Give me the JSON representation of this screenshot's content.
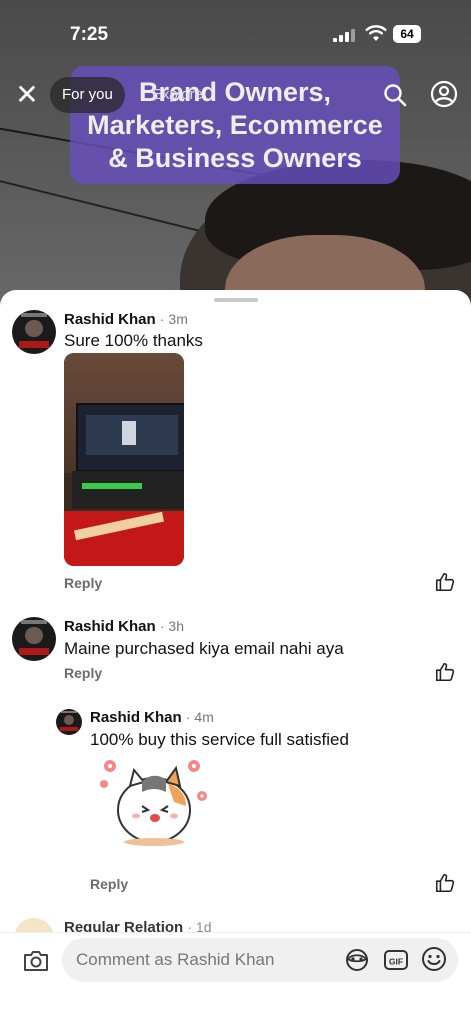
{
  "status_bar": {
    "time": "7:25",
    "battery": "64"
  },
  "top_nav": {
    "tab_for_you": "For you",
    "tab_explore": "Explore"
  },
  "overlay": {
    "text": "Brand Owners, Marketers, Ecommerce & Business Owners"
  },
  "comments": [
    {
      "name": "Rashid Khan",
      "age": "· 3m",
      "text": "Sure 100% thanks",
      "reply": "Reply"
    },
    {
      "name": "Rashid Khan",
      "age": "· 3h",
      "text": "Maine purchased kiya email nahi aya",
      "reply": "Reply"
    },
    {
      "name": "Rashid Khan",
      "age": "· 4m",
      "text": "100% buy this service full satisfied",
      "reply": "Reply"
    }
  ],
  "partial_comment": {
    "name": "Regular Relation",
    "age": "· 1d"
  },
  "input": {
    "placeholder": "Comment as Rashid Khan"
  },
  "colors": {
    "overlay": "#6a4ec0",
    "sheet": "#ffffff",
    "secondary_text": "#6b6b6b"
  }
}
